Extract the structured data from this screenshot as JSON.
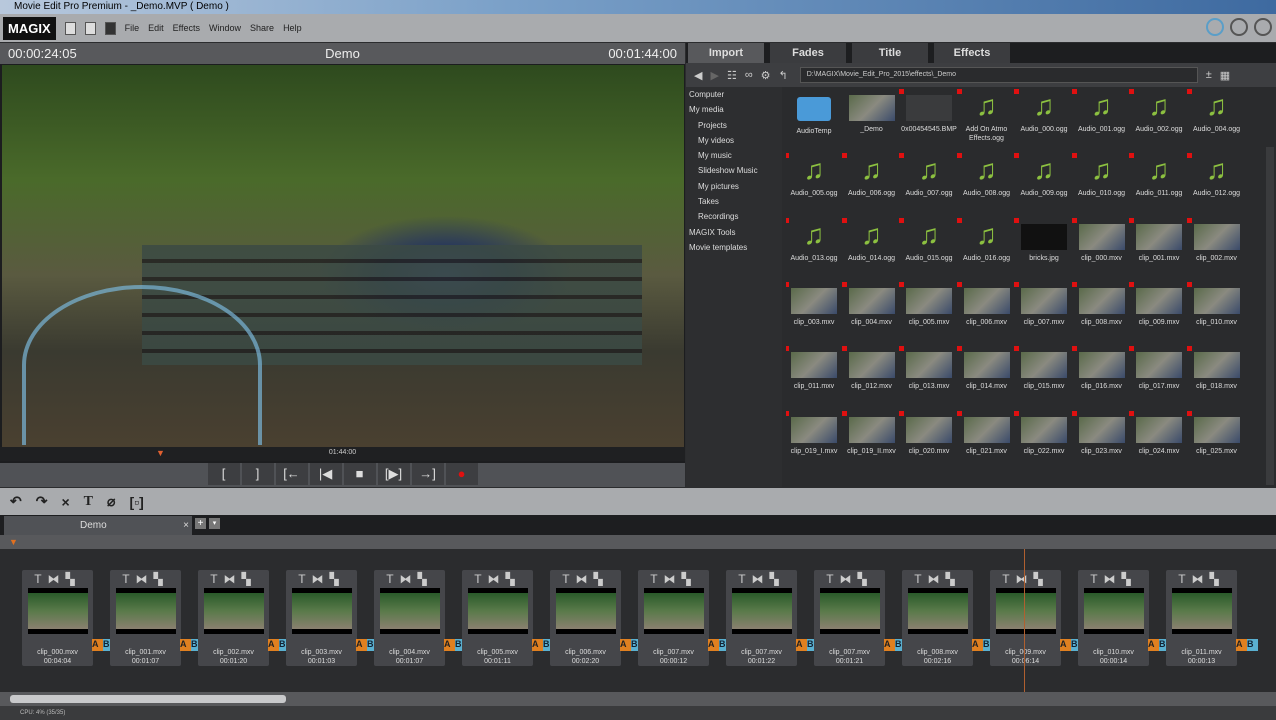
{
  "window": {
    "title": "Movie Edit Pro Premium - _Demo.MVP ( Demo )"
  },
  "menu": {
    "logo": "MAGIX",
    "items": [
      "File",
      "Edit",
      "Effects",
      "Window",
      "Share",
      "Help"
    ]
  },
  "preview": {
    "time_left": "00:00:24:05",
    "title": "Demo",
    "time_right": "00:01:44:00",
    "scrub_time": "01:44:00",
    "transport": [
      {
        "icon": "mark-in-icon",
        "g": "["
      },
      {
        "icon": "mark-out-icon",
        "g": "]"
      },
      {
        "icon": "jump-to-start-icon",
        "g": "[←"
      },
      {
        "icon": "previous-icon",
        "g": "|◀"
      },
      {
        "icon": "stop-icon",
        "g": "■"
      },
      {
        "icon": "play-icon",
        "g": "[▶]"
      },
      {
        "icon": "jump-to-end-icon",
        "g": "→]"
      },
      {
        "icon": "record-icon",
        "g": "●"
      }
    ]
  },
  "browser": {
    "tabs": [
      "Import",
      "Fades",
      "Title",
      "Effects"
    ],
    "active_tab": "Import",
    "path": "D:\\MAGIX\\Movie_Edit_Pro_2015\\effects\\_Demo",
    "sidebar": [
      {
        "label": "Computer",
        "sub": false
      },
      {
        "label": "My media",
        "sub": false
      },
      {
        "label": "Projects",
        "sub": true
      },
      {
        "label": "My videos",
        "sub": true
      },
      {
        "label": "My music",
        "sub": true
      },
      {
        "label": "Slideshow Music",
        "sub": true
      },
      {
        "label": "My pictures",
        "sub": true
      },
      {
        "label": "Takes",
        "sub": true
      },
      {
        "label": "Recordings",
        "sub": true
      },
      {
        "label": "MAGIX Tools",
        "sub": false
      },
      {
        "label": "Movie templates",
        "sub": false
      }
    ],
    "files": [
      {
        "name": "AudioTemp",
        "type": "folder"
      },
      {
        "name": "_Demo",
        "type": "video"
      },
      {
        "name": "0x00454545.BMP",
        "type": "image"
      },
      {
        "name": "Add On Atmo Effects.ogg",
        "type": "audio"
      },
      {
        "name": "Audio_000.ogg",
        "type": "audio"
      },
      {
        "name": "Audio_001.ogg",
        "type": "audio"
      },
      {
        "name": "Audio_002.ogg",
        "type": "audio"
      },
      {
        "name": "Audio_004.ogg",
        "type": "audio"
      },
      {
        "name": "Audio_005.ogg",
        "type": "audio"
      },
      {
        "name": "Audio_006.ogg",
        "type": "audio"
      },
      {
        "name": "Audio_007.ogg",
        "type": "audio"
      },
      {
        "name": "Audio_008.ogg",
        "type": "audio"
      },
      {
        "name": "Audio_009.ogg",
        "type": "audio"
      },
      {
        "name": "Audio_010.ogg",
        "type": "audio"
      },
      {
        "name": "Audio_011.ogg",
        "type": "audio"
      },
      {
        "name": "Audio_012.ogg",
        "type": "audio"
      },
      {
        "name": "Audio_013.ogg",
        "type": "audio"
      },
      {
        "name": "Audio_014.ogg",
        "type": "audio"
      },
      {
        "name": "Audio_015.ogg",
        "type": "audio"
      },
      {
        "name": "Audio_016.ogg",
        "type": "audio"
      },
      {
        "name": "bricks.jpg",
        "type": "image"
      },
      {
        "name": "clip_000.mxv",
        "type": "video"
      },
      {
        "name": "clip_001.mxv",
        "type": "video"
      },
      {
        "name": "clip_002.mxv",
        "type": "video"
      },
      {
        "name": "clip_003.mxv",
        "type": "video"
      },
      {
        "name": "clip_004.mxv",
        "type": "video"
      },
      {
        "name": "clip_005.mxv",
        "type": "video"
      },
      {
        "name": "clip_006.mxv",
        "type": "video"
      },
      {
        "name": "clip_007.mxv",
        "type": "video"
      },
      {
        "name": "clip_008.mxv",
        "type": "video"
      },
      {
        "name": "clip_009.mxv",
        "type": "video"
      },
      {
        "name": "clip_010.mxv",
        "type": "video"
      },
      {
        "name": "clip_011.mxv",
        "type": "video"
      },
      {
        "name": "clip_012.mxv",
        "type": "video"
      },
      {
        "name": "clip_013.mxv",
        "type": "video"
      },
      {
        "name": "clip_014.mxv",
        "type": "video"
      },
      {
        "name": "clip_015.mxv",
        "type": "video"
      },
      {
        "name": "clip_016.mxv",
        "type": "video"
      },
      {
        "name": "clip_017.mxv",
        "type": "video"
      },
      {
        "name": "clip_018.mxv",
        "type": "video"
      },
      {
        "name": "clip_019_I.mxv",
        "type": "video"
      },
      {
        "name": "clip_019_II.mxv",
        "type": "video"
      },
      {
        "name": "clip_020.mxv",
        "type": "video"
      },
      {
        "name": "clip_021.mxv",
        "type": "video"
      },
      {
        "name": "clip_022.mxv",
        "type": "video"
      },
      {
        "name": "clip_023.mxv",
        "type": "video"
      },
      {
        "name": "clip_024.mxv",
        "type": "video"
      },
      {
        "name": "clip_025.mxv",
        "type": "video"
      }
    ]
  },
  "timeline": {
    "tab": "Demo",
    "clips": [
      {
        "name": "clip_000.mxv",
        "dur": "00:04:04"
      },
      {
        "name": "clip_001.mxv",
        "dur": "00:01:07"
      },
      {
        "name": "clip_002.mxv",
        "dur": "00:01:20"
      },
      {
        "name": "clip_003.mxv",
        "dur": "00:01:03"
      },
      {
        "name": "clip_004.mxv",
        "dur": "00:01:07"
      },
      {
        "name": "clip_005.mxv",
        "dur": "00:01:11"
      },
      {
        "name": "clip_006.mxv",
        "dur": "00:02:20"
      },
      {
        "name": "clip_007.mxv",
        "dur": "00:00:12"
      },
      {
        "name": "clip_007.mxv",
        "dur": "00:01:22"
      },
      {
        "name": "clip_007.mxv",
        "dur": "00:01:21"
      },
      {
        "name": "clip_008.mxv",
        "dur": "00:02:16"
      },
      {
        "name": "clip_009.mxv",
        "dur": "00:06:14"
      },
      {
        "name": "clip_010.mxv",
        "dur": "00:00:14"
      },
      {
        "name": "clip_011.mxv",
        "dur": "00:00:13"
      }
    ]
  },
  "status": {
    "cpu": "CPU: 4% (35/35)"
  },
  "colors": {
    "accent": "#5a9ec8",
    "record": "#e01010",
    "transition_a": "#e08020",
    "transition_b": "#5ab0d0"
  }
}
